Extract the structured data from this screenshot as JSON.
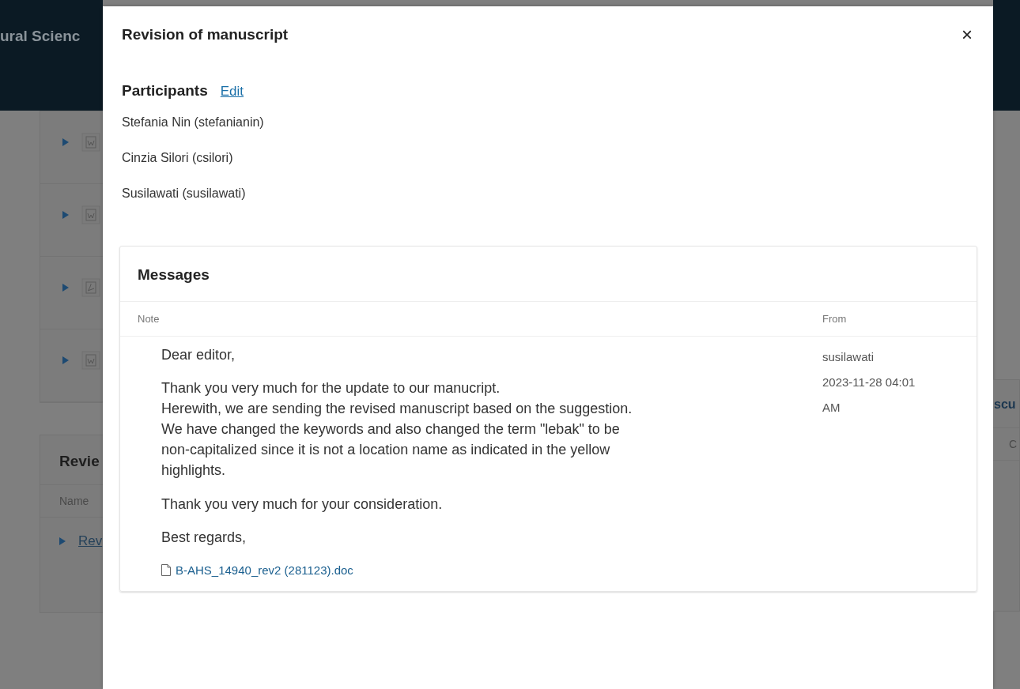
{
  "background": {
    "header_title": "ural Scienc",
    "file_rows": [
      {
        "kind": "word"
      },
      {
        "kind": "word"
      },
      {
        "kind": "pdf"
      },
      {
        "kind": "word"
      }
    ],
    "review_panel": {
      "title": "Revie",
      "column": "Name",
      "link": "Rev"
    },
    "right_edge": {
      "label": "scu",
      "column": "C"
    }
  },
  "modal": {
    "title": "Revision of manuscript",
    "close": "×",
    "participants": {
      "heading": "Participants",
      "edit": "Edit",
      "names": [
        "Stefania Nin (stefanianin)",
        "Cinzia Silori (csilori)",
        "Susilawati (susilawati)"
      ]
    },
    "messages": {
      "title": "Messages",
      "columns": [
        "Note",
        "From"
      ],
      "rows": [
        {
          "paragraphs": [
            "Dear editor,",
            "Thank you very much for the update to our manucript.\nHerewith, we are sending the revised manuscript based on the suggestion.\nWe have changed the keywords and also changed the term \"lebak\" to be\nnon-capitalized since it is not a location name as indicated in the yellow\nhighlights.",
            "Thank you very much for your consideration.",
            "Best regards,"
          ],
          "attachment": "B-AHS_14940_rev2 (281123).doc",
          "from": "susilawati",
          "date": "2023-11-28 04:01 AM"
        }
      ]
    }
  }
}
